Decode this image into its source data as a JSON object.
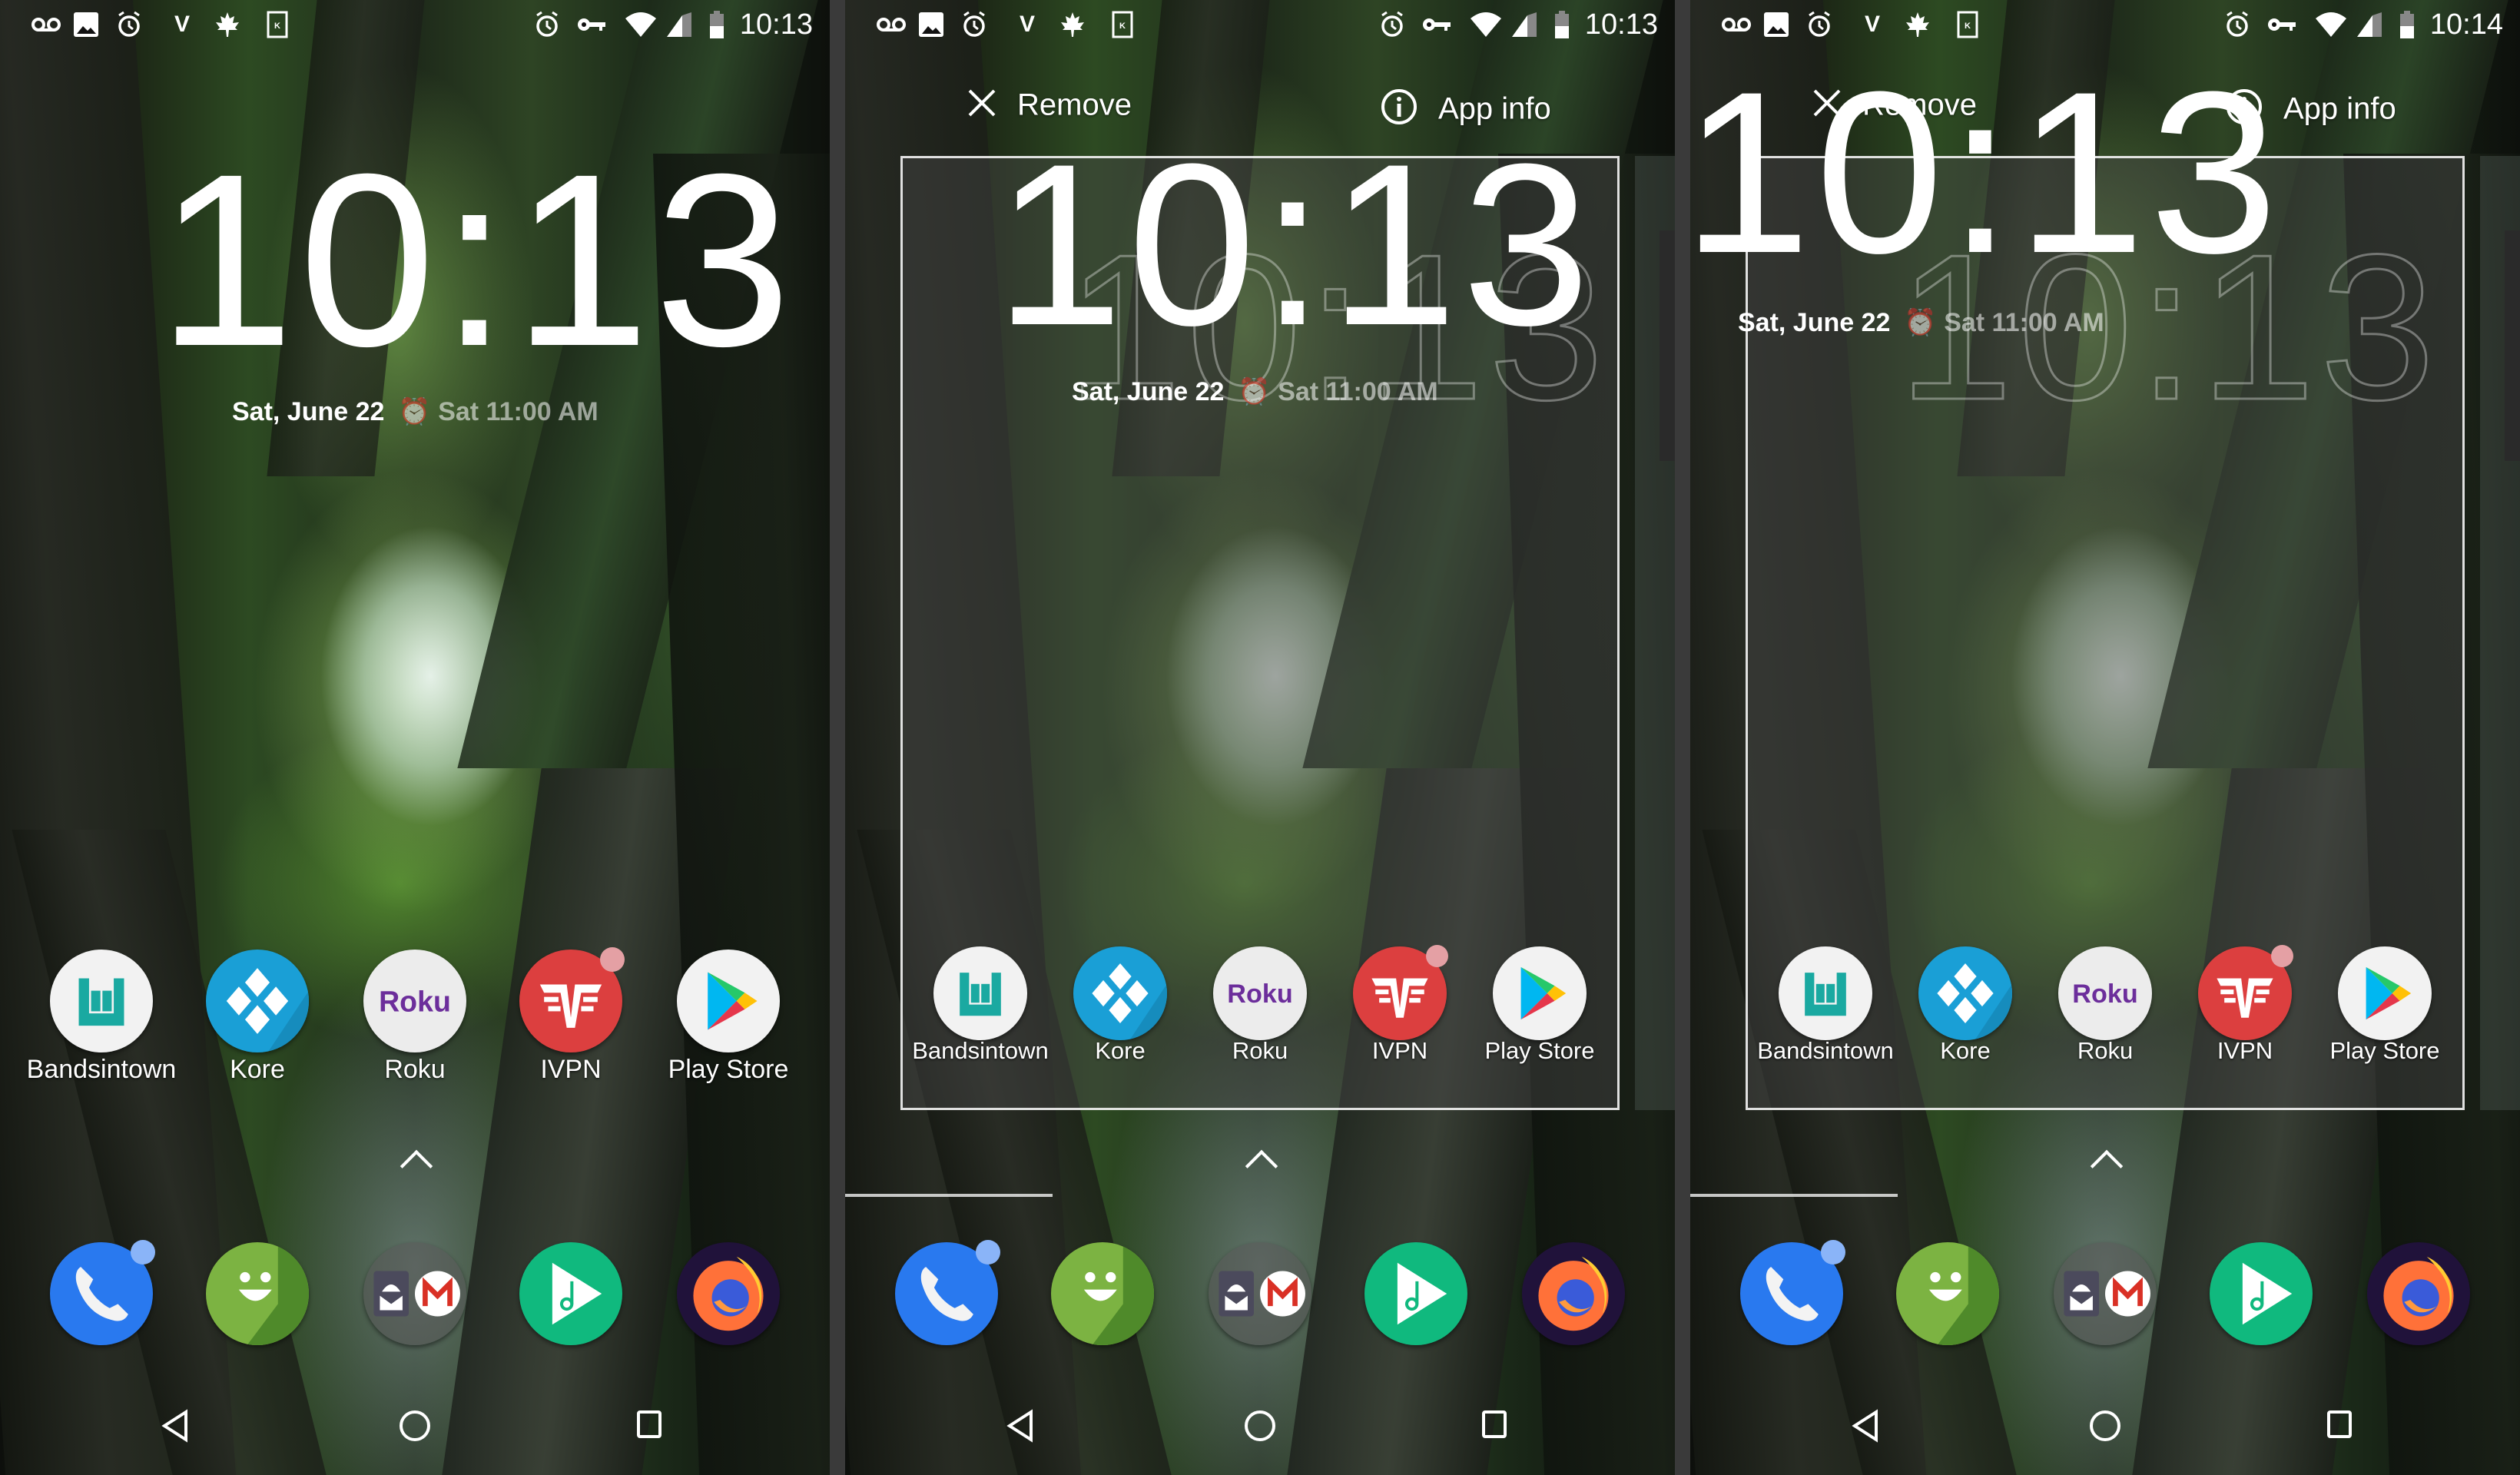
{
  "screens": [
    {
      "id": "panel-1",
      "status_time": "10:13",
      "mode": "home"
    },
    {
      "id": "panel-2",
      "status_time": "10:13",
      "mode": "drag"
    },
    {
      "id": "panel-3",
      "status_time": "10:14",
      "mode": "drag"
    }
  ],
  "status_bar": {
    "left_icons": [
      "voicemail-icon",
      "gallery-icon",
      "alarm-icon",
      "ivpn-icon",
      "maple-leaf-icon",
      "k-box-icon"
    ],
    "right_icons": [
      "alarm-icon",
      "vpn-key-icon",
      "wifi-icon",
      "cell-signal-icon",
      "battery-icon"
    ]
  },
  "clock_widget": {
    "time": "10:13",
    "date": "Sat, June 22",
    "next_alarm": "Sat 11:00 AM"
  },
  "drop_targets": {
    "remove_label": "Remove",
    "app_info_label": "App info"
  },
  "apps_row": [
    {
      "label": "Bandsintown",
      "icon": "bandsintown-icon",
      "color": "#1aa9a1",
      "bg": "#f2f2f2",
      "badge": false
    },
    {
      "label": "Kore",
      "icon": "kore-icon",
      "color": "#ffffff",
      "bg": "#1a9fd6",
      "badge": false
    },
    {
      "label": "Roku",
      "icon": "roku-icon",
      "color": "#6c2e9b",
      "bg": "#ececec",
      "badge": false,
      "text": "Roku"
    },
    {
      "label": "IVPN",
      "icon": "ivpn-icon",
      "color": "#ffffff",
      "bg": "#dc3f3f",
      "badge": true
    },
    {
      "label": "Play Store",
      "icon": "play-store-icon",
      "color": "#00c3ff",
      "bg": "#f2f2f2",
      "badge": false
    }
  ],
  "dock": [
    {
      "name": "phone",
      "icon": "phone-icon",
      "bg": "#2979ef",
      "badge": true
    },
    {
      "name": "messaging",
      "icon": "messaging-icon",
      "bg": "#7cb342",
      "badge": false
    },
    {
      "name": "mail-folder",
      "icon": "mail-folder-icon",
      "bg": "rgba(110,110,110,0.55)",
      "badge": false
    },
    {
      "name": "music",
      "icon": "music-play-icon",
      "bg": "#10b97e",
      "badge": false
    },
    {
      "name": "firefox",
      "icon": "firefox-icon",
      "bg": "#20123a",
      "badge": false
    }
  ],
  "nav_bar": {
    "back": "back-icon",
    "home": "home-icon",
    "recents": "recents-icon"
  },
  "colors": {
    "divider": "#3a3a3a",
    "badge_red": "#e4a0a4",
    "badge_blue": "#8ab4f8"
  }
}
